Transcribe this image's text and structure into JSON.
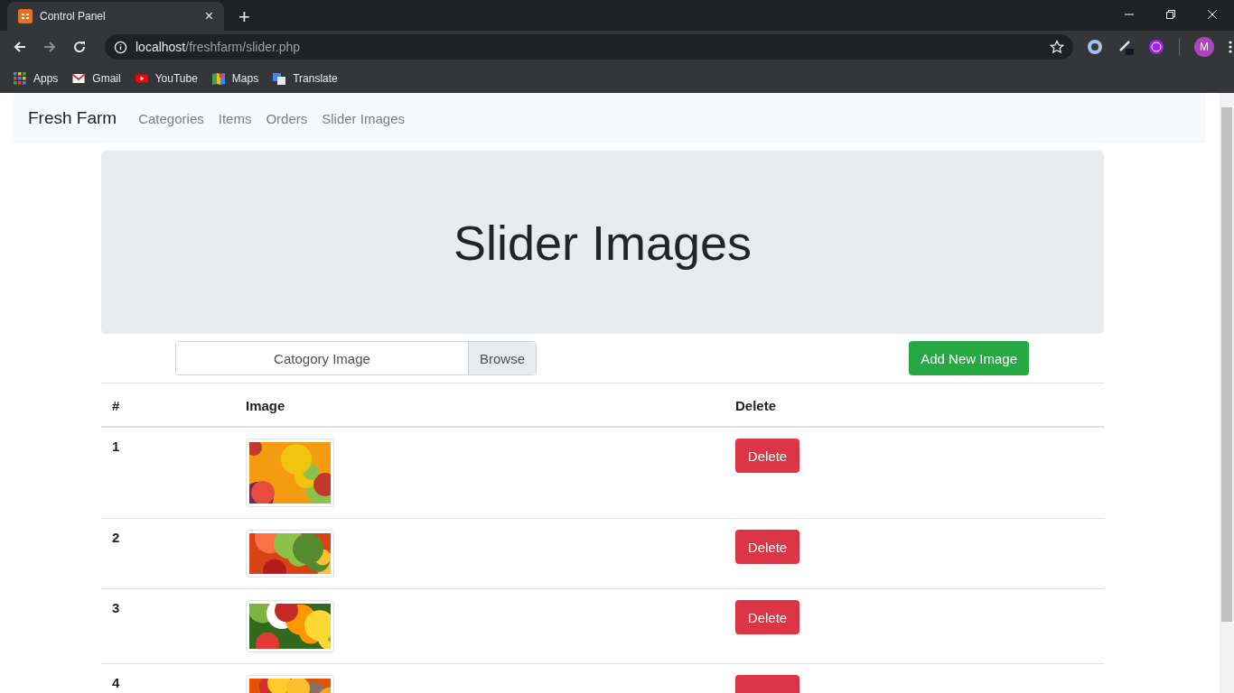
{
  "browser": {
    "tab": {
      "title": "Control Panel",
      "close": "×"
    },
    "new_tab": "+",
    "address": {
      "host": "localhost",
      "path": "/freshfarm/slider.php"
    },
    "bookmarks": [
      {
        "label": "Apps",
        "kind": "apps"
      },
      {
        "label": "Gmail",
        "kind": "gmail"
      },
      {
        "label": "YouTube",
        "kind": "youtube"
      },
      {
        "label": "Maps",
        "kind": "maps"
      },
      {
        "label": "Translate",
        "kind": "translate"
      }
    ],
    "profile": "M"
  },
  "navbar": {
    "brand": "Fresh Farm",
    "links": [
      {
        "label": "Categories"
      },
      {
        "label": "Items"
      },
      {
        "label": "Orders"
      },
      {
        "label": "Slider Images"
      }
    ]
  },
  "jumbotron": {
    "title": "Slider Images"
  },
  "upload": {
    "placeholder": "Catogory Image",
    "browse": "Browse",
    "submit": "Add New Image"
  },
  "table": {
    "columns": [
      "#",
      "Image",
      "Delete"
    ],
    "rows": [
      {
        "number": "1",
        "action": "Delete"
      },
      {
        "number": "2",
        "action": "Delete"
      },
      {
        "number": "3",
        "action": "Delete"
      },
      {
        "number": "4"
      }
    ]
  }
}
